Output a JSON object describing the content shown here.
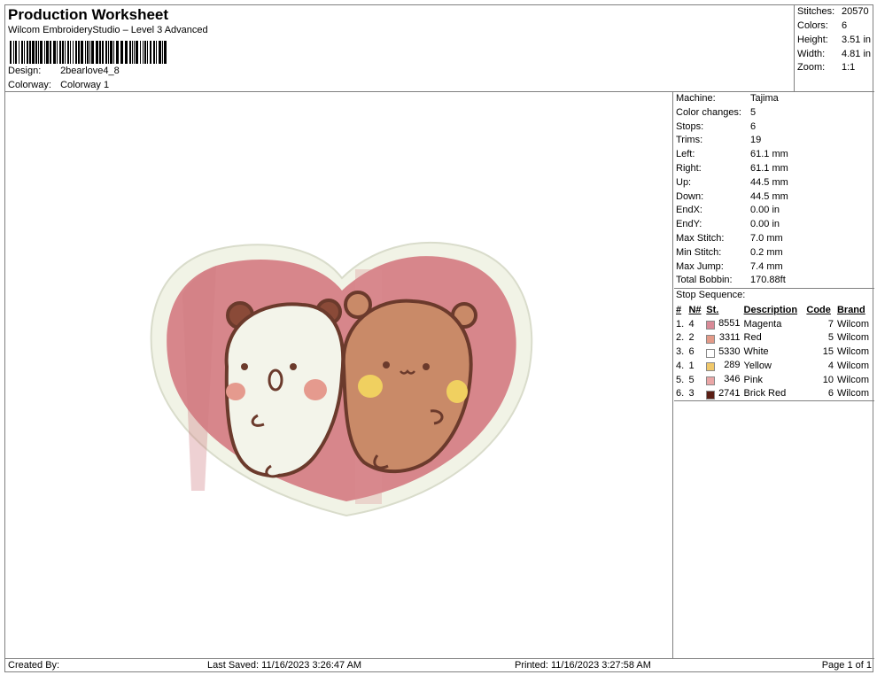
{
  "header": {
    "title": "Production Worksheet",
    "subtitle": "Wilcom EmbroideryStudio – Level 3 Advanced",
    "design_label": "Design:",
    "design_value": "2bearlove4_8",
    "colorway_label": "Colorway:",
    "colorway_value": "Colorway 1"
  },
  "stats": [
    {
      "label": "Stitches:",
      "value": "20570"
    },
    {
      "label": "Colors:",
      "value": "6"
    },
    {
      "label": "Height:",
      "value": "3.51 in"
    },
    {
      "label": "Width:",
      "value": "4.81 in"
    },
    {
      "label": "Zoom:",
      "value": "1:1"
    }
  ],
  "machine_info": [
    {
      "label": "Machine:",
      "value": "Tajima"
    },
    {
      "label": "Color changes:",
      "value": "5"
    },
    {
      "label": "Stops:",
      "value": "6"
    },
    {
      "label": "Trims:",
      "value": "19"
    },
    {
      "label": "Left:",
      "value": "61.1 mm"
    },
    {
      "label": "Right:",
      "value": "61.1 mm"
    },
    {
      "label": "Up:",
      "value": "44.5 mm"
    },
    {
      "label": "Down:",
      "value": "44.5 mm"
    },
    {
      "label": "EndX:",
      "value": "0.00 in"
    },
    {
      "label": "EndY:",
      "value": "0.00 in"
    },
    {
      "label": "Max Stitch:",
      "value": "7.0 mm"
    },
    {
      "label": "Min Stitch:",
      "value": "0.2 mm"
    },
    {
      "label": "Max Jump:",
      "value": "7.4 mm"
    },
    {
      "label": "Total Bobbin:",
      "value": "170.88ft"
    }
  ],
  "stop_sequence": {
    "title": "Stop Sequence:",
    "columns": [
      "#",
      "N#",
      "St.",
      "Description",
      "Code",
      "Brand"
    ],
    "rows": [
      {
        "idx": "1.",
        "n": "4",
        "color": "#d98a97",
        "st": "8551",
        "desc": "Magenta",
        "code": "7",
        "brand": "Wilcom"
      },
      {
        "idx": "2.",
        "n": "2",
        "color": "#e39a88",
        "st": "3311",
        "desc": "Red",
        "code": "5",
        "brand": "Wilcom"
      },
      {
        "idx": "3.",
        "n": "6",
        "color": "#ffffff",
        "st": "5330",
        "desc": "White",
        "code": "15",
        "brand": "Wilcom"
      },
      {
        "idx": "4.",
        "n": "1",
        "color": "#f0c86a",
        "st": "289",
        "desc": "Yellow",
        "code": "4",
        "brand": "Wilcom"
      },
      {
        "idx": "5.",
        "n": "5",
        "color": "#eaa6a6",
        "st": "346",
        "desc": "Pink",
        "code": "10",
        "brand": "Wilcom"
      },
      {
        "idx": "6.",
        "n": "3",
        "color": "#5a1e14",
        "st": "2741",
        "desc": "Brick Red",
        "code": "6",
        "brand": "Wilcom"
      }
    ]
  },
  "footer": {
    "created_by": "Created By:",
    "last_saved": "Last Saved: 11/16/2023 3:26:47 AM",
    "printed": "Printed: 11/16/2023 3:27:58 AM",
    "page": "Page 1 of 1"
  },
  "colors": {
    "border": "#808080",
    "heart_fill": "#d7868b",
    "heart_rim": "#f1f3e6",
    "bear_outline": "#6b3a2c",
    "white_bear": "#f3f4ea",
    "brown_bear": "#c98a68",
    "cheek_pink": "#e59a8e",
    "cheek_yellow": "#f0d060"
  }
}
